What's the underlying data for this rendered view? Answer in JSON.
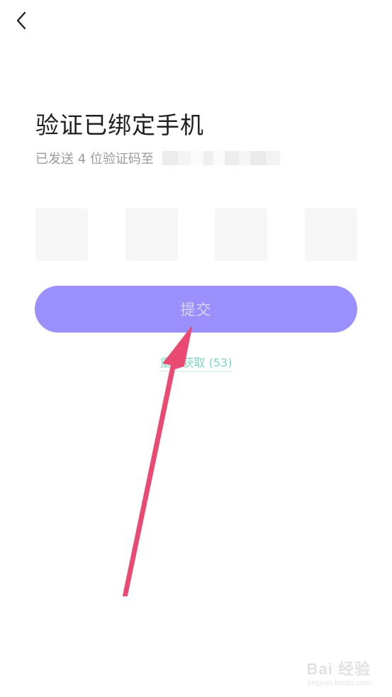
{
  "header": {
    "back_icon": "chevron-left-icon"
  },
  "title": "验证已绑定手机",
  "subtitle": "已发送 4 位验证码至",
  "code_inputs": [
    {
      "value": ""
    },
    {
      "value": ""
    },
    {
      "value": ""
    },
    {
      "value": ""
    }
  ],
  "submit": {
    "label": "提交"
  },
  "resend": {
    "label": "重新获取 (53)"
  },
  "colors": {
    "accent": "#9a8ffb",
    "resend_text": "#7fd6c0",
    "arrow": "#ea4a72"
  },
  "watermark": {
    "logo": "Bai 经验",
    "url": "jingyan.baidu.com"
  }
}
